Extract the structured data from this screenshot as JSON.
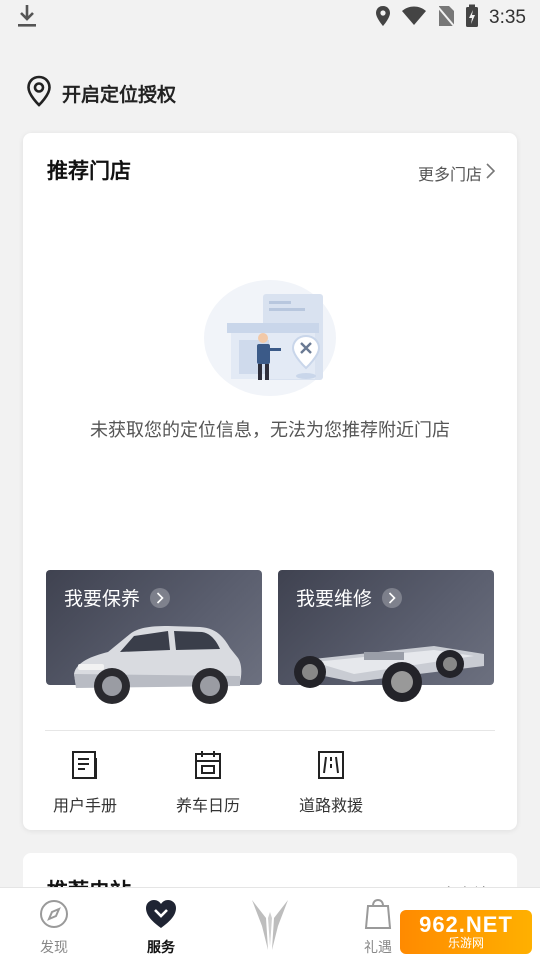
{
  "status_bar": {
    "time": "3:35"
  },
  "location": {
    "label": "开启定位授权"
  },
  "store_card": {
    "title": "推荐门店",
    "more": "更多门店",
    "empty_message": "未获取您的定位信息，无法为您推荐附近门店"
  },
  "service_tiles": [
    {
      "label": "我要保养"
    },
    {
      "label": "我要维修"
    }
  ],
  "quick_links": [
    {
      "label": "用户手册",
      "icon": "manual-icon"
    },
    {
      "label": "养车日历",
      "icon": "calendar-icon"
    },
    {
      "label": "道路救援",
      "icon": "road-rescue-icon"
    }
  ],
  "second_card": {
    "title": "推荐电站",
    "more": "更多电站"
  },
  "tabbar": {
    "tabs": [
      {
        "label": "发现",
        "icon": "compass-icon",
        "active": false
      },
      {
        "label": "服务",
        "icon": "heart-chevron-icon",
        "active": true
      },
      {
        "label": "",
        "icon": "brand-logo-icon",
        "active": false
      },
      {
        "label": "礼遇",
        "icon": "bag-icon",
        "active": false
      }
    ]
  },
  "watermark": {
    "main": "962.NET",
    "sub": "乐游网"
  },
  "colors": {
    "tile_dark": "#4a4d5b",
    "accent_text": "#222222",
    "illustration_blue": "#c9d6ea"
  }
}
